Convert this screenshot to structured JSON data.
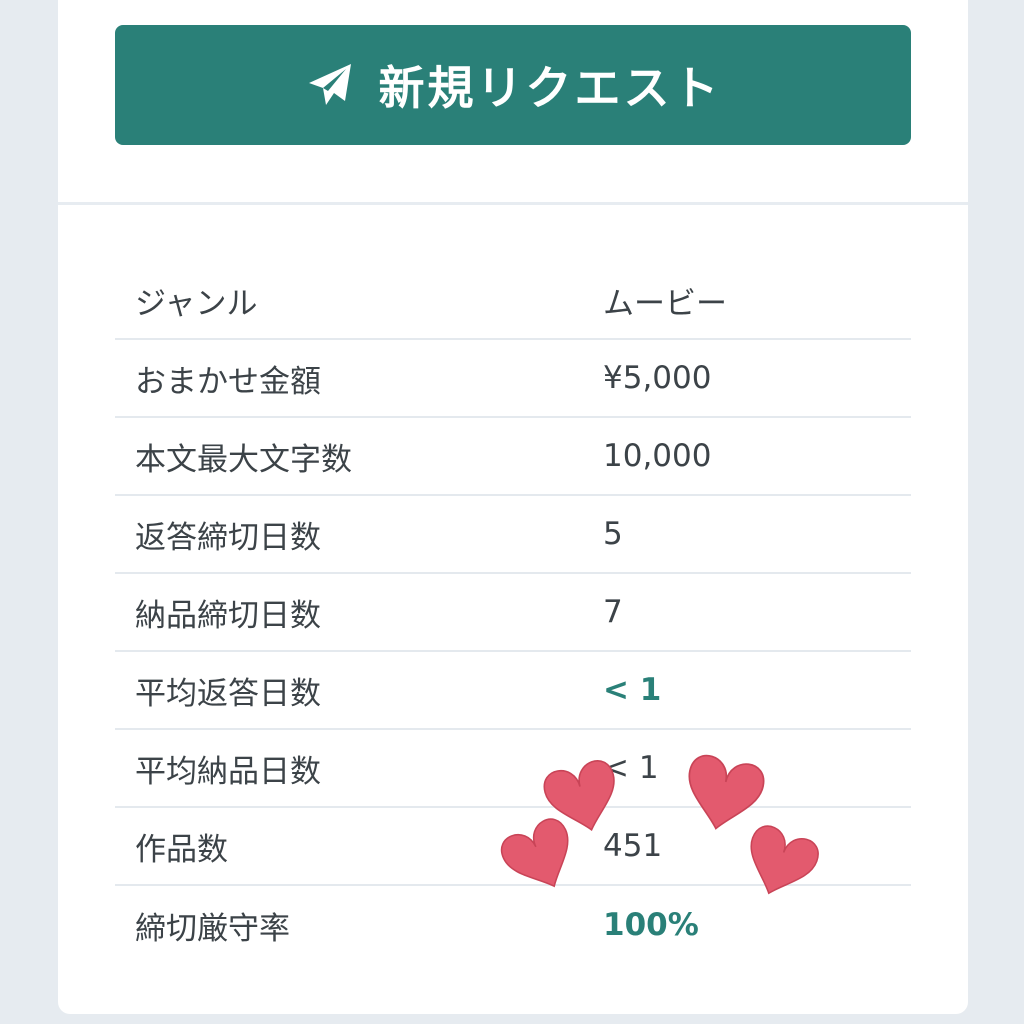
{
  "request_button": {
    "label": "新規リクエスト",
    "icon": "paper-plane-icon",
    "color": "#2a8078"
  },
  "info_rows": [
    {
      "label": "ジャンル",
      "value": "ムービー"
    },
    {
      "label": "おまかせ金額",
      "value": "¥5,000"
    },
    {
      "label": "本文最大文字数",
      "value": "10,000"
    },
    {
      "label": "返答締切日数",
      "value": "5"
    },
    {
      "label": "納品締切日数",
      "value": "7"
    },
    {
      "label": "平均返答日数",
      "value": "< 1",
      "accent": true
    },
    {
      "label": "平均納品日数",
      "value": "< 1"
    },
    {
      "label": "作品数",
      "value": "451"
    },
    {
      "label": "締切厳守率",
      "value": "100%",
      "accent": true
    }
  ],
  "accent_color": "#2a8078",
  "sticker": {
    "icon": "hearts-sticker",
    "color": "#e35a6e"
  }
}
